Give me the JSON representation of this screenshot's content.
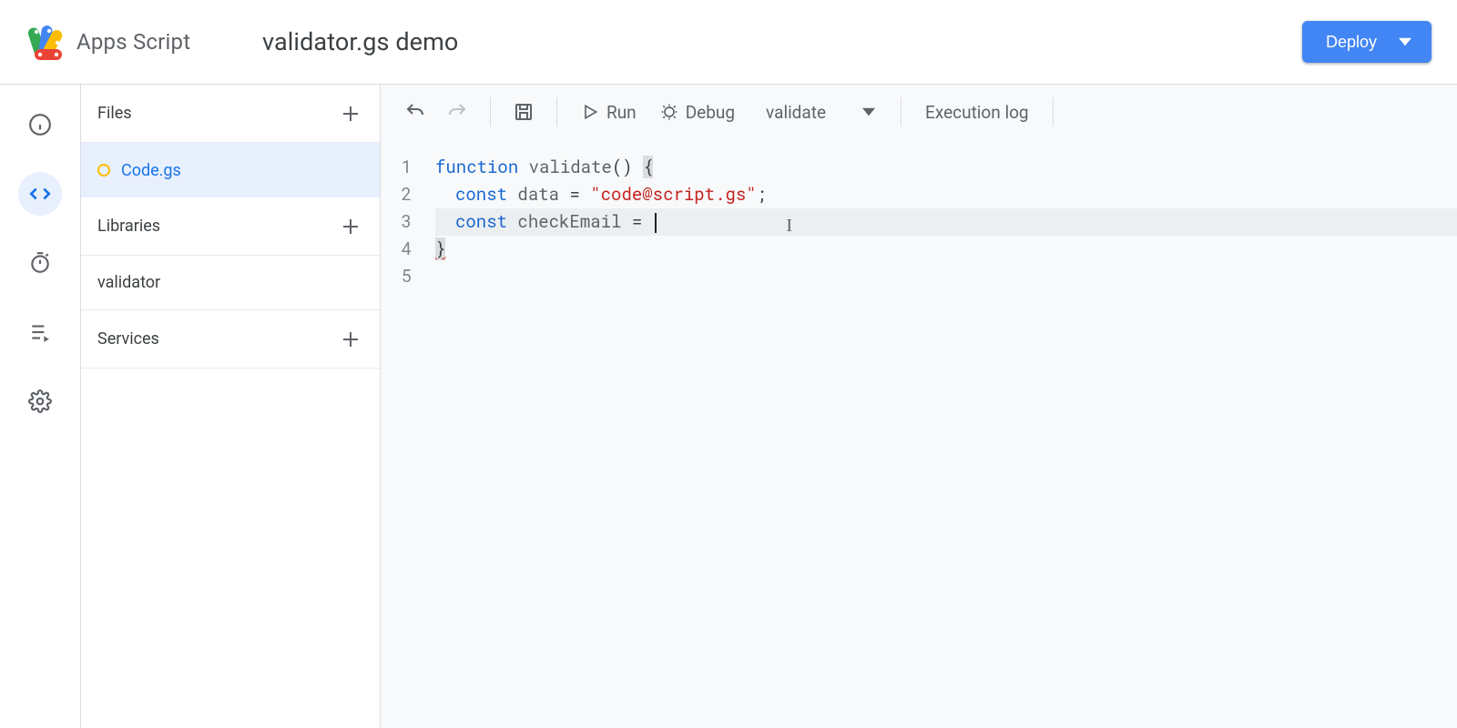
{
  "header": {
    "product_name": "Apps Script",
    "project_title": "validator.gs demo",
    "deploy_label": "Deploy"
  },
  "sidebar": {
    "files_label": "Files",
    "files": [
      {
        "name": "Code.gs"
      }
    ],
    "libraries_label": "Libraries",
    "libraries": [
      {
        "name": "validator"
      }
    ],
    "services_label": "Services"
  },
  "toolbar": {
    "run_label": "Run",
    "debug_label": "Debug",
    "selected_function": "validate",
    "execution_log_label": "Execution log"
  },
  "editor": {
    "line_numbers": [
      "1",
      "2",
      "3",
      "4",
      "5"
    ],
    "code": {
      "l1": {
        "kw1": "function",
        "name": "validate",
        "parens": "()",
        "brace": "{"
      },
      "l2": {
        "kw": "const",
        "var": "data",
        "eq": "=",
        "str": "\"code@script.gs\"",
        "semi": ";"
      },
      "l3": {
        "kw": "const",
        "var": "checkEmail",
        "eq": "="
      },
      "l4": {
        "brace": "}"
      }
    }
  }
}
